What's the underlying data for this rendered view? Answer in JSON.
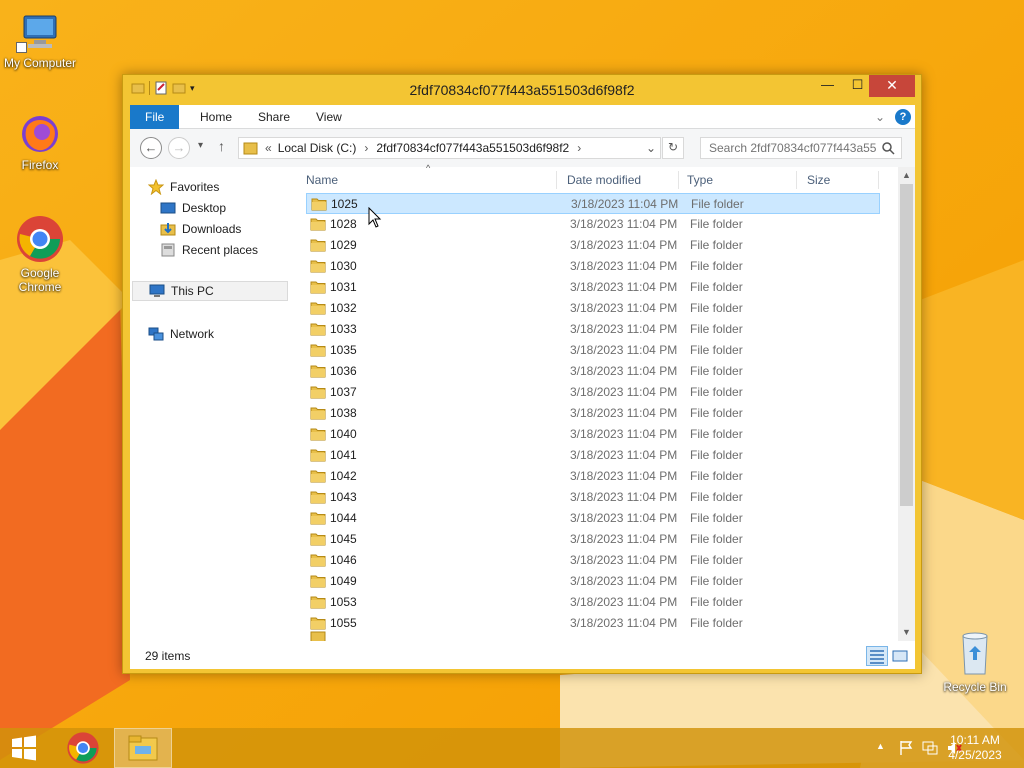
{
  "colors": {
    "accent": "#1979ca",
    "selection": "#cce8ff",
    "close": "#c7463a",
    "wallpaper": "#f7a700"
  },
  "desktop": {
    "icons": [
      {
        "label": "My Computer",
        "icon": "computer-icon"
      },
      {
        "label": "Firefox",
        "icon": "firefox-icon"
      },
      {
        "label": "Google Chrome",
        "icon": "chrome-icon"
      },
      {
        "label": "Recycle Bin",
        "icon": "recycle-bin-icon"
      }
    ]
  },
  "window": {
    "title": "2fdf70834cf077f443a551503d6f98f2",
    "minimize": "—",
    "maximize": "☐",
    "close": "✕"
  },
  "ribbon": {
    "tabs": [
      "File",
      "Home",
      "Share",
      "View"
    ],
    "expand": "⌄",
    "help": "?"
  },
  "navbar": {
    "back": "←",
    "forward": "→",
    "recent": "▾",
    "up": "↑",
    "breadcrumb_overflow": "«",
    "crumbs": [
      "Local Disk (C:)",
      "2fdf70834cf077f443a551503d6f98f2"
    ],
    "crumb_sep": "›",
    "address_dropdown": "⌄",
    "refresh": "↻",
    "search_placeholder": "Search 2fdf70834cf077f443a55..."
  },
  "navpane": {
    "favorites": "Favorites",
    "favorites_items": [
      "Desktop",
      "Downloads",
      "Recent places"
    ],
    "this_pc": "This PC",
    "network": "Network"
  },
  "filelist": {
    "columns": [
      "Name",
      "Date modified",
      "Type",
      "Size"
    ],
    "sort_indicator": "^",
    "rows": [
      {
        "name": "1025",
        "date": "3/18/2023 11:04 PM",
        "type": "File folder"
      },
      {
        "name": "1028",
        "date": "3/18/2023 11:04 PM",
        "type": "File folder"
      },
      {
        "name": "1029",
        "date": "3/18/2023 11:04 PM",
        "type": "File folder"
      },
      {
        "name": "1030",
        "date": "3/18/2023 11:04 PM",
        "type": "File folder"
      },
      {
        "name": "1031",
        "date": "3/18/2023 11:04 PM",
        "type": "File folder"
      },
      {
        "name": "1032",
        "date": "3/18/2023 11:04 PM",
        "type": "File folder"
      },
      {
        "name": "1033",
        "date": "3/18/2023 11:04 PM",
        "type": "File folder"
      },
      {
        "name": "1035",
        "date": "3/18/2023 11:04 PM",
        "type": "File folder"
      },
      {
        "name": "1036",
        "date": "3/18/2023 11:04 PM",
        "type": "File folder"
      },
      {
        "name": "1037",
        "date": "3/18/2023 11:04 PM",
        "type": "File folder"
      },
      {
        "name": "1038",
        "date": "3/18/2023 11:04 PM",
        "type": "File folder"
      },
      {
        "name": "1040",
        "date": "3/18/2023 11:04 PM",
        "type": "File folder"
      },
      {
        "name": "1041",
        "date": "3/18/2023 11:04 PM",
        "type": "File folder"
      },
      {
        "name": "1042",
        "date": "3/18/2023 11:04 PM",
        "type": "File folder"
      },
      {
        "name": "1043",
        "date": "3/18/2023 11:04 PM",
        "type": "File folder"
      },
      {
        "name": "1044",
        "date": "3/18/2023 11:04 PM",
        "type": "File folder"
      },
      {
        "name": "1045",
        "date": "3/18/2023 11:04 PM",
        "type": "File folder"
      },
      {
        "name": "1046",
        "date": "3/18/2023 11:04 PM",
        "type": "File folder"
      },
      {
        "name": "1049",
        "date": "3/18/2023 11:04 PM",
        "type": "File folder"
      },
      {
        "name": "1053",
        "date": "3/18/2023 11:04 PM",
        "type": "File folder"
      },
      {
        "name": "1055",
        "date": "3/18/2023 11:04 PM",
        "type": "File folder"
      }
    ],
    "selected_index": 0
  },
  "status": {
    "item_count": "29 items"
  },
  "taskbar": {
    "items": [
      "start-icon",
      "chrome-icon",
      "file-explorer-icon"
    ],
    "time": "10:11 AM",
    "date": "4/25/2023",
    "tray_expand": "▲"
  }
}
